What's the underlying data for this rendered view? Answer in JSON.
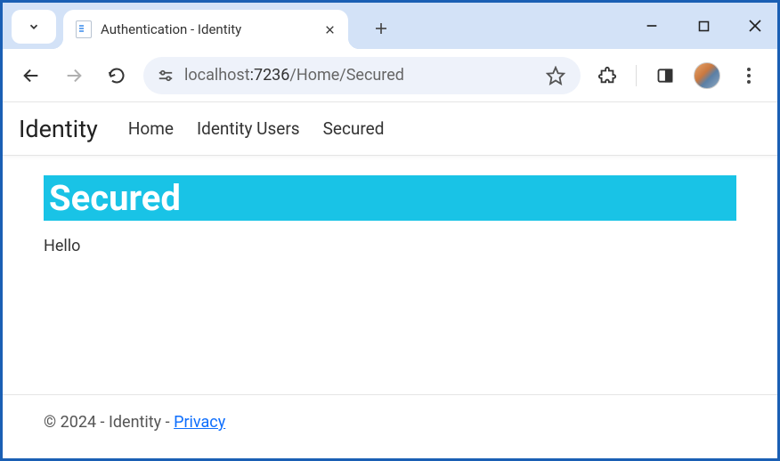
{
  "browser": {
    "tab_title": "Authentication - Identity",
    "url_host_prefix": "localhost",
    "url_host_port": ":7236",
    "url_path": "/Home/Secured"
  },
  "navbar": {
    "brand": "Identity",
    "links": [
      "Home",
      "Identity Users",
      "Secured"
    ]
  },
  "page": {
    "heading": "Secured",
    "body_text": "Hello"
  },
  "footer": {
    "text_prefix": "© 2024 - Identity - ",
    "privacy_label": "Privacy"
  }
}
